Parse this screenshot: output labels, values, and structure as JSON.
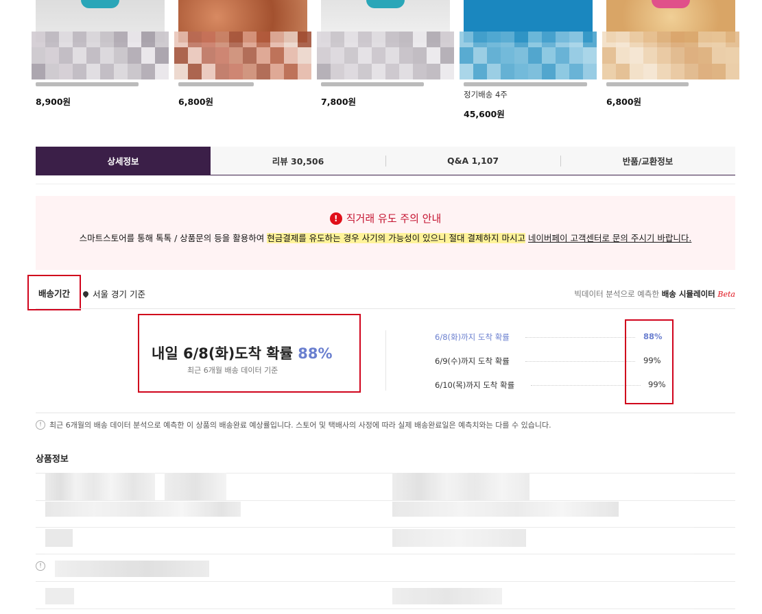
{
  "products": [
    {
      "price": "8,900원",
      "image_colors": [
        "#d9d9d9",
        "#e8e8e8",
        "#cfcfcf"
      ],
      "pixel_colors": [
        "#cfc8cf",
        "#b9b3bb",
        "#a9a2ab",
        "#c7c2c8",
        "#dcd8dd",
        "#c2bdc3",
        "#9d97a1",
        "#b8b3bb",
        "#d6d2d7",
        "#e6e3e7"
      ]
    },
    {
      "price": "6,800원",
      "image_colors": [
        "#c97a55",
        "#a85a3a",
        "#e0b08f"
      ],
      "pixel_colors": [
        "#e7c2b5",
        "#c9846a",
        "#b35a3d",
        "#9e4a30",
        "#c5715a",
        "#d99a84",
        "#ead2c7",
        "#b86a55",
        "#a4553c",
        "#e3b4a3"
      ]
    },
    {
      "price": "7,800원",
      "image_colors": [
        "#eeeeee",
        "#f6f6f6",
        "#dddddd"
      ],
      "pixel_colors": [
        "#d8d3d9",
        "#c6c0c7",
        "#b7b1b8",
        "#ccc7cd",
        "#e1dde2",
        "#bfbac1",
        "#a9a3ac",
        "#c4bfc6",
        "#dcd8dd",
        "#e9e6ea"
      ]
    },
    {
      "name_line": "정기배송 4주",
      "price": "45,600원",
      "image_colors": [
        "#1d8fc4",
        "#1680b8",
        "#2799ce"
      ],
      "pixel_colors": [
        "#8ac6df",
        "#67b4d6",
        "#4fa6cf",
        "#3c9cc9",
        "#5aaed3",
        "#7abfdd",
        "#9bcfe5",
        "#4aa3cd",
        "#3496c5",
        "#86c3df"
      ]
    },
    {
      "price": "6,800원",
      "image_colors": [
        "#e8c28a",
        "#d9a566",
        "#f0d3a4"
      ],
      "pixel_colors": [
        "#f1dcc0",
        "#e6c194",
        "#d9a76d",
        "#e0b684",
        "#ecd0ab",
        "#d8a26a",
        "#e9c89c",
        "#f3e2cb",
        "#ddb07e",
        "#e8c59a"
      ]
    }
  ],
  "tabs": [
    {
      "label": "상세정보",
      "active": true
    },
    {
      "label": "리뷰 30,506",
      "active": false
    },
    {
      "label": "Q&A 1,107",
      "active": false
    },
    {
      "label": "반품/교환정보",
      "active": false
    }
  ],
  "notice": {
    "title": "직거래 유도 주의 안내",
    "text_prefix": "스마트스토어를 통해 톡톡 / 상품문의 등을 활용하여 ",
    "text_highlight": "현금결제를 유도하는 경우 사기의 가능성이 있으니 절대 결제하지 마시고",
    "text_space": " ",
    "text_link": "네이버페이 고객센터로 문의 주시기 바랍니다."
  },
  "delivery": {
    "label": "배송기간",
    "location": "서울 경기 기준",
    "simulator_prefix": "빅데이터 분석으로 예측한 ",
    "simulator_bold": "배송 시뮬레이터",
    "simulator_beta": "Beta",
    "headline_text": "내일 6/8(화)도착 확률 ",
    "headline_pct": "88%",
    "headline_sub": "최근 6개월 배송 데이터 기준",
    "rows": [
      {
        "label": "6/8(화)까지 도착 확률",
        "value": "88%"
      },
      {
        "label": "6/9(수)까지 도착 확률",
        "value": "99%"
      },
      {
        "label": "6/10(목)까지 도착 확률",
        "value": "99%"
      }
    ],
    "note": "최근 6개월의 배송 데이터 분석으로 예측한 이 상품의 배송완료 예상률입니다. 스토어 및 택배사의 사정에 따라 실제 배송완료일은 예측치와는 다를 수 있습니다."
  },
  "product_info": {
    "title": "상품정보"
  },
  "colors": {
    "accent": "#3b1f48",
    "highlight_red": "#d0021b",
    "percent_blue": "#6a7fcf"
  }
}
